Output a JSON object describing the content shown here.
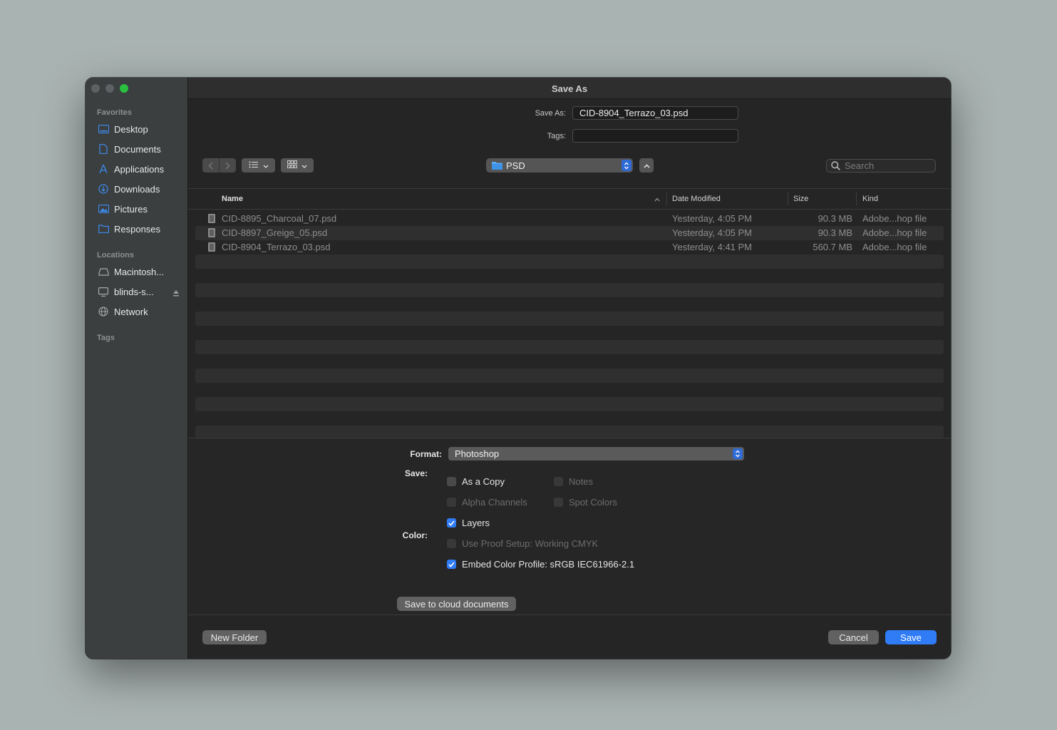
{
  "window": {
    "title": "Save As"
  },
  "sidebar": {
    "favorites_label": "Favorites",
    "favorites": [
      {
        "label": "Desktop",
        "icon": "desktop-icon"
      },
      {
        "label": "Documents",
        "icon": "document-icon"
      },
      {
        "label": "Applications",
        "icon": "applications-icon"
      },
      {
        "label": "Downloads",
        "icon": "downloads-icon"
      },
      {
        "label": "Pictures",
        "icon": "pictures-icon"
      },
      {
        "label": "Responses",
        "icon": "folder-icon"
      }
    ],
    "locations_label": "Locations",
    "locations": [
      {
        "label": "Macintosh...",
        "icon": "disk-icon"
      },
      {
        "label": "blinds-s...",
        "icon": "computer-icon"
      },
      {
        "label": "Network",
        "icon": "network-icon"
      }
    ],
    "tags_label": "Tags"
  },
  "form": {
    "save_as_label": "Save As:",
    "save_as_value": "CID-8904_Terrazo_03.psd",
    "tags_label": "Tags:",
    "tags_value": ""
  },
  "toolbar": {
    "location": "PSD",
    "search_placeholder": "Search"
  },
  "columns": {
    "name": "Name",
    "date": "Date Modified",
    "size": "Size",
    "kind": "Kind"
  },
  "files": [
    {
      "name": "CID-8895_Charcoal_07.psd",
      "date": "Yesterday, 4:05 PM",
      "size": "90.3 MB",
      "kind": "Adobe...hop file"
    },
    {
      "name": "CID-8897_Greige_05.psd",
      "date": "Yesterday, 4:05 PM",
      "size": "90.3 MB",
      "kind": "Adobe...hop file"
    },
    {
      "name": "CID-8904_Terrazo_03.psd",
      "date": "Yesterday, 4:41 PM",
      "size": "560.7 MB",
      "kind": "Adobe...hop file"
    }
  ],
  "options": {
    "format_label": "Format:",
    "format_value": "Photoshop",
    "save_label": "Save:",
    "as_copy": {
      "label": "As a Copy",
      "checked": false
    },
    "notes": {
      "label": "Notes",
      "checked": false
    },
    "alpha_channels": {
      "label": "Alpha Channels",
      "checked": false
    },
    "spot_colors": {
      "label": "Spot Colors",
      "checked": false
    },
    "layers": {
      "label": "Layers",
      "checked": true
    },
    "color_label": "Color:",
    "use_proof_setup": {
      "label": "Use Proof Setup:  Working CMYK",
      "checked": false
    },
    "embed_color_profile": {
      "label": "Embed Color Profile:  sRGB IEC61966-2.1",
      "checked": true
    },
    "cloud_button": "Save to cloud documents"
  },
  "footer": {
    "new_folder": "New Folder",
    "cancel": "Cancel",
    "save": "Save"
  },
  "colors": {
    "accent": "#2f7cf6",
    "close_max": "#29c13f"
  }
}
